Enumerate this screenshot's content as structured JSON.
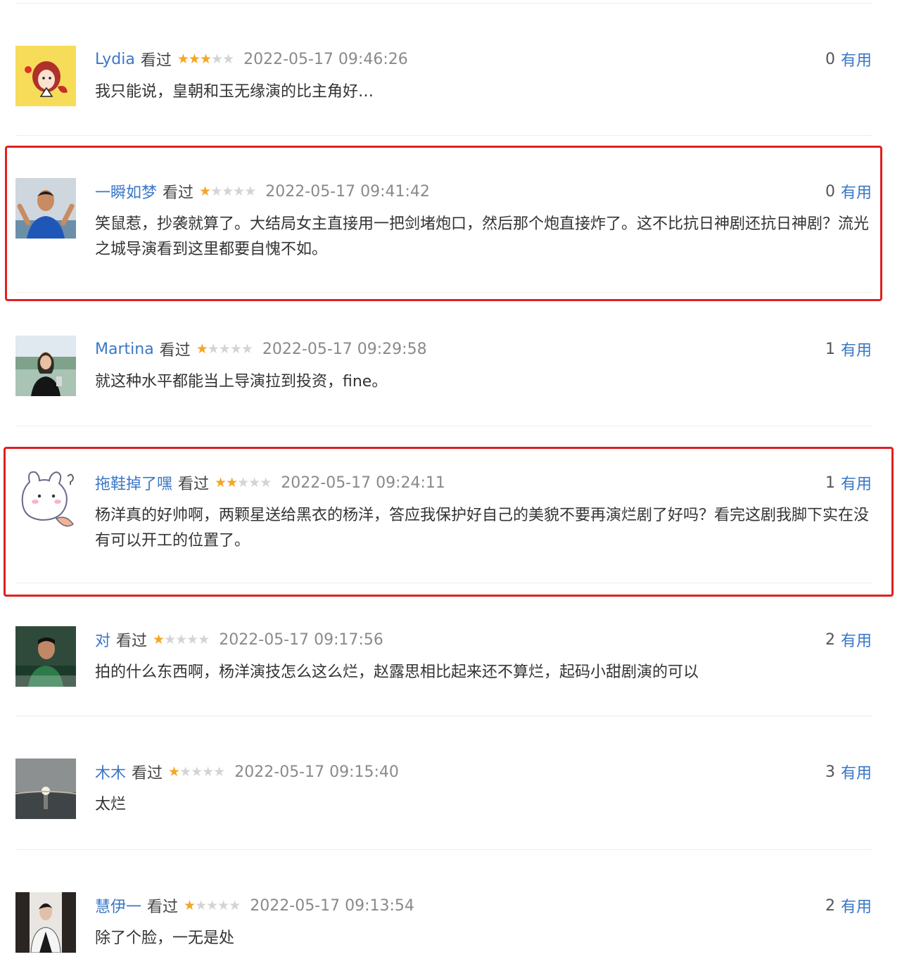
{
  "comments": [
    {
      "user": "Lydia",
      "action": "看过",
      "rating": 3,
      "time": "2022-05-17 09:46:26",
      "useful_count": "0",
      "useful_label": "有用",
      "text": "我只能说，皇朝和玉无缘演的比主角好…"
    },
    {
      "user": "一瞬如梦",
      "action": "看过",
      "rating": 1,
      "time": "2022-05-17 09:41:42",
      "useful_count": "0",
      "useful_label": "有用",
      "text": "笑鼠惹，抄袭就算了。大结局女主直接用一把剑堵炮口，然后那个炮直接炸了。这不比抗日神剧还抗日神剧？流光之城导演看到这里都要自愧不如。"
    },
    {
      "user": "Martina",
      "action": "看过",
      "rating": 1,
      "time": "2022-05-17 09:29:58",
      "useful_count": "1",
      "useful_label": "有用",
      "text": "就这种水平都能当上导演拉到投资，fine。"
    },
    {
      "user": "拖鞋掉了嘿",
      "action": "看过",
      "rating": 2,
      "time": "2022-05-17 09:24:11",
      "useful_count": "1",
      "useful_label": "有用",
      "text": "杨洋真的好帅啊，两颗星送给黑衣的杨洋，答应我保护好自己的美貌不要再演烂剧了好吗？看完这剧我脚下实在没有可以开工的位置了。"
    },
    {
      "user": "对",
      "action": "看过",
      "rating": 1,
      "time": "2022-05-17 09:17:56",
      "useful_count": "2",
      "useful_label": "有用",
      "text": "拍的什么东西啊，杨洋演技怎么这么烂，赵露思相比起来还不算烂，起码小甜剧演的可以"
    },
    {
      "user": "木木",
      "action": "看过",
      "rating": 1,
      "time": "2022-05-17 09:15:40",
      "useful_count": "3",
      "useful_label": "有用",
      "text": "太烂"
    },
    {
      "user": "慧伊一",
      "action": "看过",
      "rating": 1,
      "time": "2022-05-17 09:13:54",
      "useful_count": "2",
      "useful_label": "有用",
      "text": "除了个脸，一无是处"
    }
  ],
  "colors": {
    "username": "#3a77c7",
    "star_on": "#f5a623",
    "star_off": "#d4d4d4",
    "highlight": "#e02020"
  }
}
